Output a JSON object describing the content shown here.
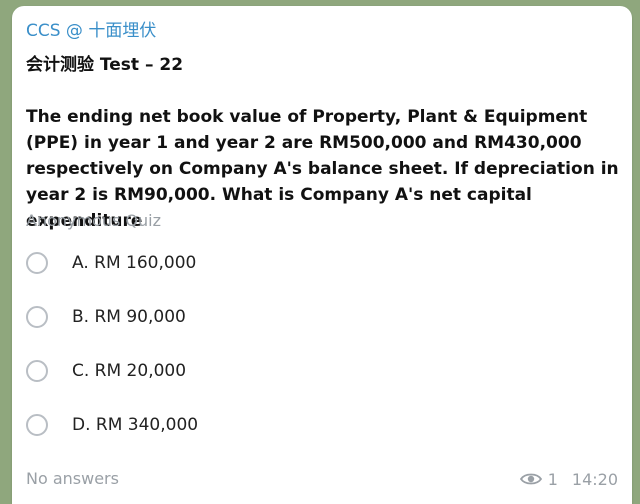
{
  "message": {
    "sender": "CCS @ 十面埋伏",
    "quiz_title": "会计测验 Test – 22",
    "question": "The ending net book value of Property, Plant & Equipment (PPE) in year 1 and year 2 are RM500,000 and RM430,000 respectively on Company A's balance sheet.   If depreciation in year 2 is RM90,000. What is Company A's net capital expenditure",
    "quiz_type": "Anonymous Quiz",
    "options": [
      {
        "label": "A. RM 160,000"
      },
      {
        "label": "B. RM 90,000"
      },
      {
        "label": "C. RM 20,000"
      },
      {
        "label": "D. RM 340,000"
      }
    ],
    "answers_status": "No answers",
    "views": "1",
    "time": "14:20",
    "icons": {
      "views": "eye-icon"
    },
    "colors": {
      "sender": "#3a8fc9",
      "muted": "#9aa0a6",
      "background": "#8fa77d"
    }
  }
}
